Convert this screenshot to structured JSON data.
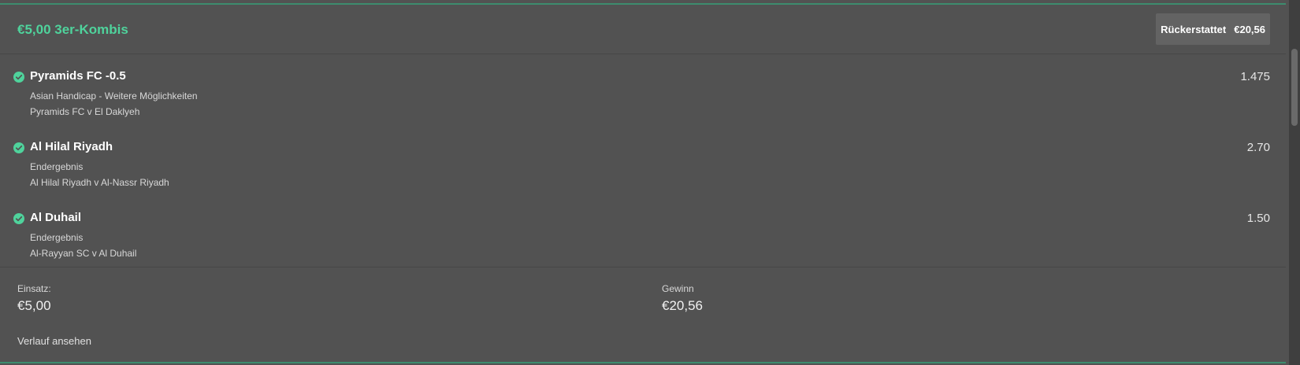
{
  "header": {
    "title": "€5,00 3er-Kombis",
    "refund_label": "Rückerstattet",
    "refund_amount": "€20,56"
  },
  "selections": [
    {
      "name": "Pyramids FC -0.5",
      "market": "Asian Handicap - Weitere Möglichkeiten",
      "event": "Pyramids FC v El Daklyeh",
      "odds": "1.475",
      "status_icon": "check-circle-icon"
    },
    {
      "name": "Al Hilal Riyadh",
      "market": "Endergebnis",
      "event": "Al Hilal Riyadh v Al-Nassr Riyadh",
      "odds": "2.70",
      "status_icon": "check-circle-icon"
    },
    {
      "name": "Al Duhail",
      "market": "Endergebnis",
      "event": "Al-Rayyan SC v Al Duhail",
      "odds": "1.50",
      "status_icon": "check-circle-icon"
    }
  ],
  "footer": {
    "stake_label": "Einsatz:",
    "stake_value": "€5,00",
    "win_label": "Gewinn",
    "win_value": "€20,56",
    "history_link": "Verlauf ansehen"
  },
  "colors": {
    "accent": "#4fd39c",
    "background": "#525252",
    "badge": "#636363"
  }
}
